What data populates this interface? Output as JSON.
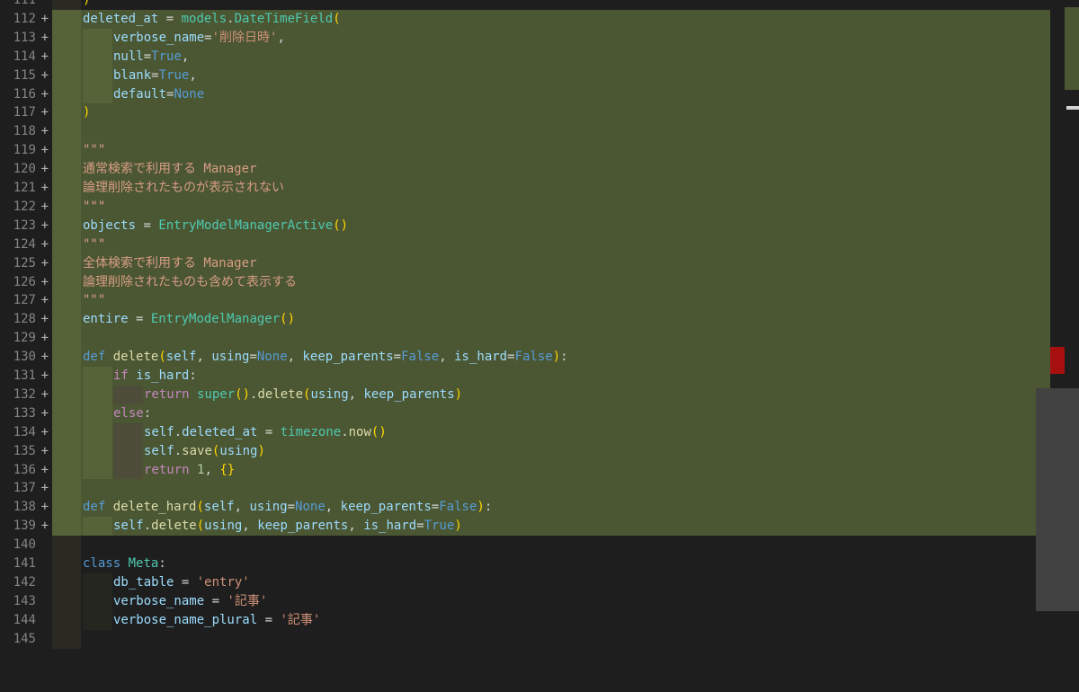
{
  "editor": {
    "lines": [
      {
        "n": "111",
        "added": false,
        "indent": "i1",
        "html": "<span class=\"br\">)</span>"
      },
      {
        "n": "112",
        "added": true,
        "indent": "i1",
        "html": "<span class=\"var\">deleted_at</span> = <span class=\"cls\">models</span>.<span class=\"cls\">DateTimeField</span><span class=\"br\">(</span>"
      },
      {
        "n": "113",
        "added": true,
        "indent": "i2",
        "html": "<span class=\"var\">verbose_name</span>=<span class=\"str\">'削除日時'</span>,"
      },
      {
        "n": "114",
        "added": true,
        "indent": "i2",
        "html": "<span class=\"var\">null</span>=<span class=\"kw\">True</span>,"
      },
      {
        "n": "115",
        "added": true,
        "indent": "i2",
        "html": "<span class=\"var\">blank</span>=<span class=\"kw\">True</span>,"
      },
      {
        "n": "116",
        "added": true,
        "indent": "i2",
        "html": "<span class=\"var\">default</span>=<span class=\"kw\">None</span>"
      },
      {
        "n": "117",
        "added": true,
        "indent": "i1",
        "html": "<span class=\"br\">)</span>"
      },
      {
        "n": "118",
        "added": true,
        "indent": "i1",
        "html": ""
      },
      {
        "n": "119",
        "added": true,
        "indent": "i1",
        "html": "<span class=\"cm\">\"\"\"</span>"
      },
      {
        "n": "120",
        "added": true,
        "indent": "i1",
        "html": "<span class=\"cm\">通常検索で利用する Manager</span>"
      },
      {
        "n": "121",
        "added": true,
        "indent": "i1",
        "html": "<span class=\"cm\">論理削除されたものが表示されない</span>"
      },
      {
        "n": "122",
        "added": true,
        "indent": "i1",
        "html": "<span class=\"cm\">\"\"\"</span>"
      },
      {
        "n": "123",
        "added": true,
        "indent": "i1",
        "html": "<span class=\"var\">objects</span> = <span class=\"cls\">EntryModelManagerActive</span><span class=\"br\">()</span>"
      },
      {
        "n": "124",
        "added": true,
        "indent": "i1",
        "html": "<span class=\"cm\">\"\"\"</span>"
      },
      {
        "n": "125",
        "added": true,
        "indent": "i1",
        "html": "<span class=\"cm\">全体検索で利用する Manager</span>"
      },
      {
        "n": "126",
        "added": true,
        "indent": "i1",
        "html": "<span class=\"cm\">論理削除されたものも含めて表示する</span>"
      },
      {
        "n": "127",
        "added": true,
        "indent": "i1",
        "html": "<span class=\"cm\">\"\"\"</span>"
      },
      {
        "n": "128",
        "added": true,
        "indent": "i1",
        "html": "<span class=\"var\">entire</span> = <span class=\"cls\">EntryModelManager</span><span class=\"br\">()</span>"
      },
      {
        "n": "129",
        "added": true,
        "indent": "i1",
        "html": ""
      },
      {
        "n": "130",
        "added": true,
        "indent": "i1",
        "html": "<span class=\"kw\">def</span> <span class=\"fn\">delete</span><span class=\"br\">(</span><span class=\"var\">self</span>, <span class=\"var\">using</span>=<span class=\"kw\">None</span>, <span class=\"var\">keep_parents</span>=<span class=\"kw\">False</span>, <span class=\"var\">is_hard</span>=<span class=\"kw\">False</span><span class=\"br\">)</span>:"
      },
      {
        "n": "131",
        "added": true,
        "indent": "i2",
        "html": "<span class=\"ctl\">if</span> <span class=\"var\">is_hard</span>:"
      },
      {
        "n": "132",
        "added": true,
        "indent": "i3",
        "html": "<span class=\"ctl\">return</span> <span class=\"cls\">super</span><span class=\"br\">()</span>.<span class=\"fn\">delete</span><span class=\"br\">(</span><span class=\"var\">using</span>, <span class=\"var\">keep_parents</span><span class=\"br\">)</span>"
      },
      {
        "n": "133",
        "added": true,
        "indent": "i2",
        "html": "<span class=\"ctl\">else</span>:"
      },
      {
        "n": "134",
        "added": true,
        "indent": "i3",
        "html": "<span class=\"var\">self</span>.<span class=\"var\">deleted_at</span> = <span class=\"cls\">timezone</span>.<span class=\"fn\">now</span><span class=\"br\">()</span>"
      },
      {
        "n": "135",
        "added": true,
        "indent": "i3",
        "html": "<span class=\"var\">self</span>.<span class=\"fn\">save</span><span class=\"br\">(</span><span class=\"var\">using</span><span class=\"br\">)</span>"
      },
      {
        "n": "136",
        "added": true,
        "indent": "i3",
        "html": "<span class=\"ctl\">return</span> <span class=\"num\">1</span>, <span class=\"br\">{}</span>"
      },
      {
        "n": "137",
        "added": true,
        "indent": "i1",
        "html": ""
      },
      {
        "n": "138",
        "added": true,
        "indent": "i1",
        "html": "<span class=\"kw\">def</span> <span class=\"fn\">delete_hard</span><span class=\"br\">(</span><span class=\"var\">self</span>, <span class=\"var\">using</span>=<span class=\"kw\">None</span>, <span class=\"var\">keep_parents</span>=<span class=\"kw\">False</span><span class=\"br\">)</span>:"
      },
      {
        "n": "139",
        "added": true,
        "indent": "i2",
        "html": "<span class=\"var\">self</span>.<span class=\"fn\">delete</span><span class=\"br\">(</span><span class=\"var\">using</span>, <span class=\"var\">keep_parents</span>, <span class=\"var\">is_hard</span>=<span class=\"kw\">True</span><span class=\"br\">)</span>"
      },
      {
        "n": "140",
        "added": false,
        "indent": "i1",
        "html": ""
      },
      {
        "n": "141",
        "added": false,
        "indent": "i1",
        "html": "<span class=\"kw\">class</span> <span class=\"cls\">Meta</span>:"
      },
      {
        "n": "142",
        "added": false,
        "indent": "i2",
        "html": "<span class=\"var\">db_table</span> = <span class=\"str\">'entry'</span>"
      },
      {
        "n": "143",
        "added": false,
        "indent": "i2",
        "html": "<span class=\"var\">verbose_name</span> = <span class=\"str\">'記事'</span>"
      },
      {
        "n": "144",
        "added": false,
        "indent": "i2",
        "html": "<span class=\"var\">verbose_name_plural</span> = <span class=\"str\">'記事'</span>"
      },
      {
        "n": "145",
        "added": false,
        "indent": "i1",
        "html": ""
      }
    ],
    "added_marker": "+",
    "colors": {
      "background": "#1e1e1e",
      "added_line": "#4b5632",
      "line_number": "#858585"
    }
  }
}
